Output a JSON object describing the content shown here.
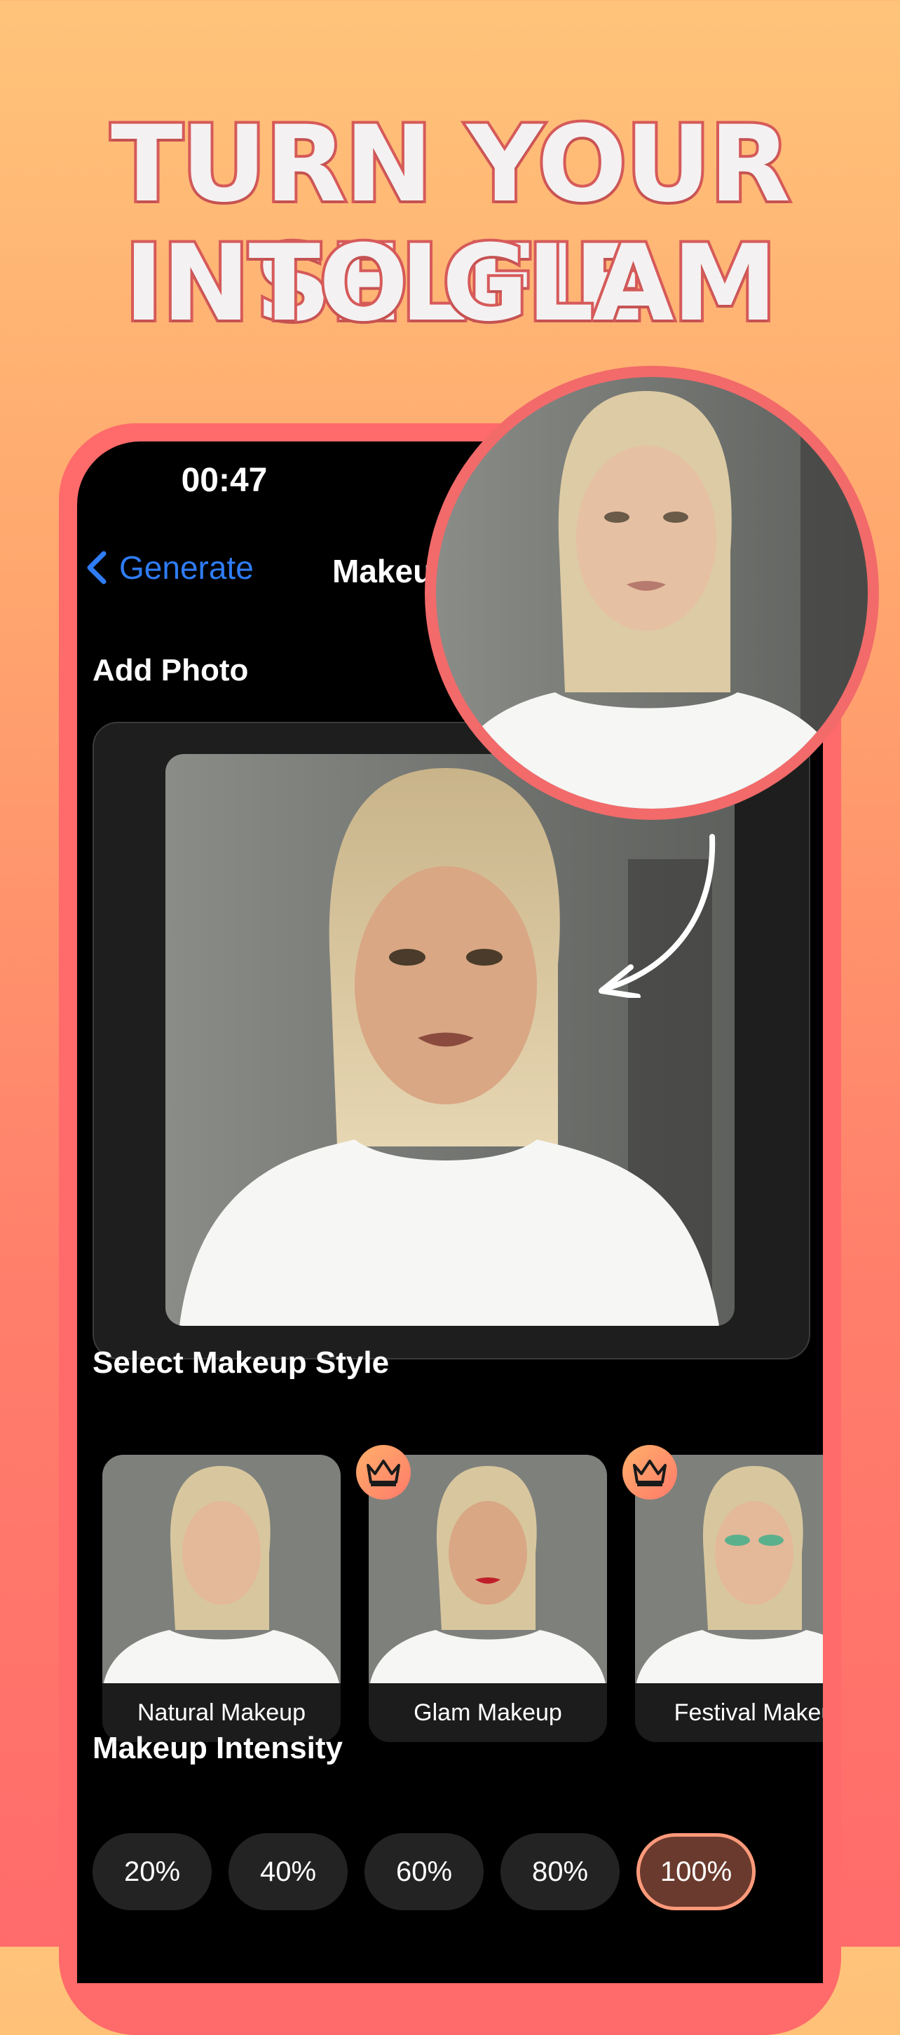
{
  "headline": {
    "line1": "TURN YOUR SELFIE",
    "line2": "INTO GLAM"
  },
  "status": {
    "time": "00:47"
  },
  "nav": {
    "back_label": "Generate",
    "title": "Makeu"
  },
  "add_photo": {
    "label": "Add Photo"
  },
  "styles": {
    "label": "Select Makeup Style",
    "items": [
      {
        "label": "Natural Makeup",
        "premium": false
      },
      {
        "label": "Glam Makeup",
        "premium": true
      },
      {
        "label": "Festival Makeu",
        "premium": true
      }
    ]
  },
  "intensity": {
    "label": "Makeup Intensity",
    "options": [
      "20%",
      "40%",
      "60%",
      "80%",
      "100%"
    ],
    "selected": "100%"
  },
  "colors": {
    "accent_blue": "#2f7cf6",
    "phone_frame": "#ff6a6a",
    "chip_active": "#6a3a2e",
    "chip_active_border": "#ff9a7a"
  }
}
